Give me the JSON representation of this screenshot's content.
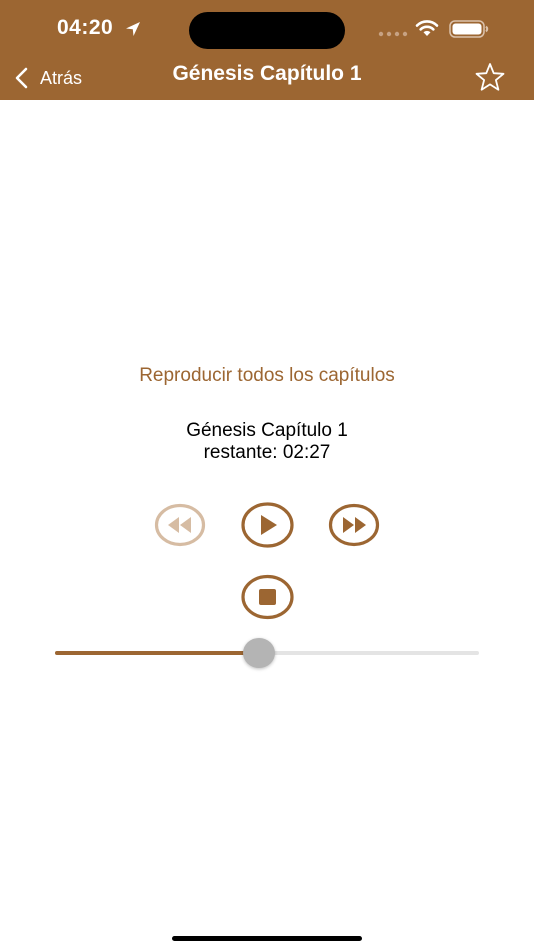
{
  "status_bar": {
    "time": "04:20",
    "icons": [
      "location-arrow-icon",
      "dynamic-island",
      "cellular-signal-icon",
      "wifi-icon",
      "battery-icon"
    ]
  },
  "nav": {
    "back_label": "Atrás",
    "title": "Génesis Capítulo 1",
    "favorite_icon": "star-outline-icon"
  },
  "player": {
    "play_all_label": "Reproducir todos los capítulos",
    "track_title": "Génesis Capítulo 1",
    "remaining_label": "restante:",
    "remaining_time": "02:27",
    "controls": [
      "rewind-icon",
      "play-icon",
      "fast-forward-icon",
      "stop-icon"
    ],
    "rewind_enabled": false,
    "progress_fraction": 0.48
  },
  "colors": {
    "accent": "#9c6632",
    "disabled_accent": "#d6bca3",
    "background": "#ffffff",
    "thumb": "#b4b4b4",
    "track": "#e4e4e4"
  }
}
